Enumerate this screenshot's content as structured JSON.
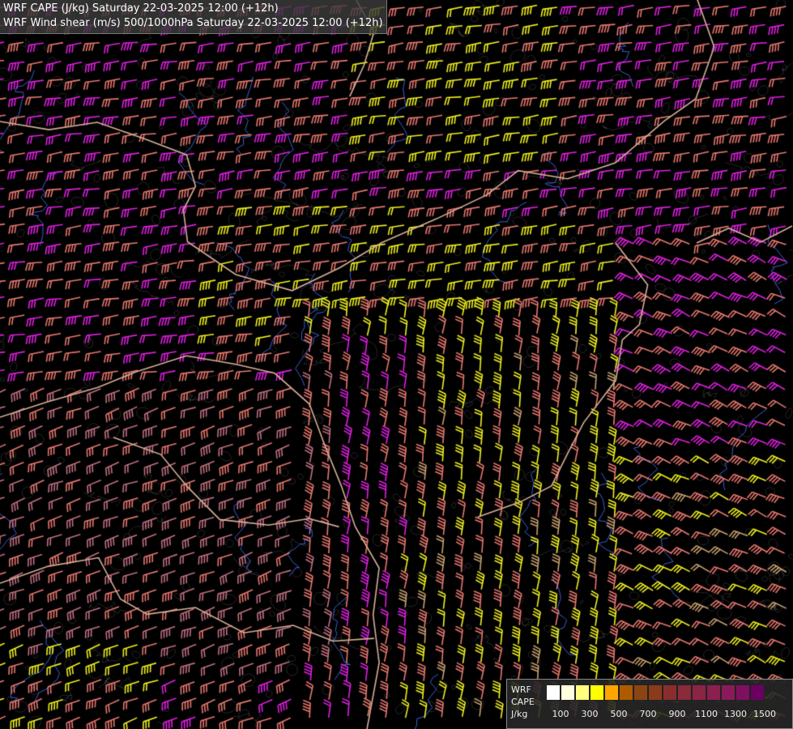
{
  "title": {
    "line1": "WRF CAPE (J/kg) Saturday 22-03-2025 12:00 (+12h)",
    "line2": "WRF Wind shear (m/s) 500/1000hPa Saturday 22-03-2025 12:00 (+12h)"
  },
  "legend": {
    "labels": [
      "WRF",
      "CAPE",
      "J/kg"
    ],
    "colors": [
      "#ffffff",
      "#ffffe0",
      "#ffff80",
      "#ffff00",
      "#ffa500",
      "#b05a00",
      "#8b4513",
      "#8b3a1a",
      "#8b2d2d",
      "#8b2a3a",
      "#8b2545",
      "#8b1f4f",
      "#8b1a5a",
      "#7f1060",
      "#6b0060"
    ],
    "ticks": [
      "100",
      "300",
      "500",
      "700",
      "900",
      "1100",
      "1300",
      "1500"
    ]
  },
  "map": {
    "background": "#000000",
    "barb_colors": {
      "magenta": "#e020e0",
      "salmon": "#e87870",
      "yellow": "#f0f020",
      "tan": "#c8a070",
      "rose": "#c07080"
    },
    "border_color": "#d8b098",
    "river_color": "#3a5fd0",
    "contour_color": "#9a9a9a"
  }
}
